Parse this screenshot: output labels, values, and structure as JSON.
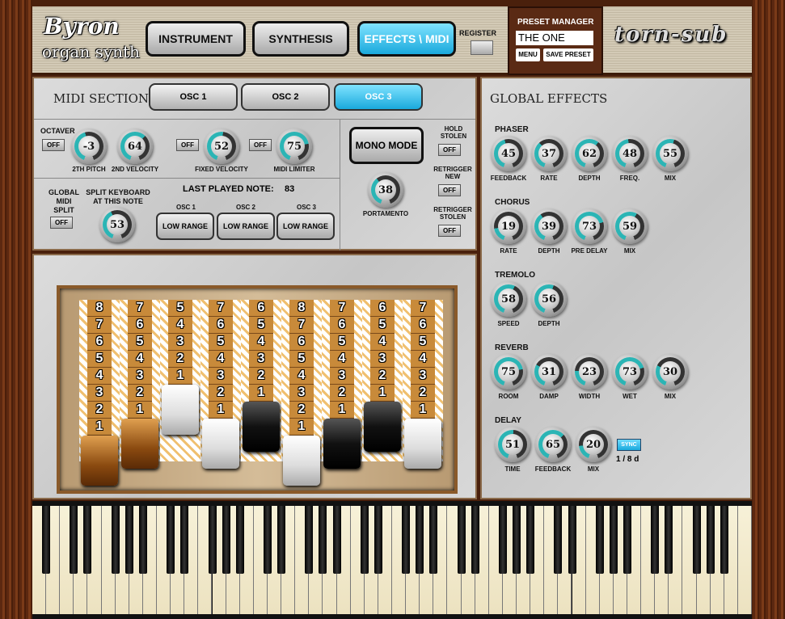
{
  "header": {
    "logo_title": "Byron",
    "logo_subtitle": "organ synth",
    "tabs": [
      {
        "label": "INSTRUMENT"
      },
      {
        "label": "SYNTHESIS"
      },
      {
        "label": "EFFECTS \\ MIDI",
        "active": true
      }
    ],
    "register_label": "REGISTER",
    "brand": "torn-sub"
  },
  "preset": {
    "title": "PRESET MANAGER",
    "name": "THE ONE",
    "menu": "MENU",
    "save": "SAVE PRESET"
  },
  "midi": {
    "title": "MIDI SECTION",
    "osc_tabs": [
      "OSC 1",
      "OSC 2",
      "OSC 3"
    ],
    "active_osc": "OSC 3",
    "octaver_label": "OCTAVER",
    "off": "OFF",
    "knobs": {
      "pitch": {
        "value": "-3",
        "level": 0.45,
        "label": "2TH PITCH"
      },
      "velocity2": {
        "value": "64",
        "level": 0.64,
        "label": "2ND VELOCITY"
      },
      "fixed": {
        "value": "52",
        "level": 0.52,
        "label": "FIXED VELOCITY"
      },
      "limiter": {
        "value": "75",
        "level": 0.75,
        "label": "MIDI LIMITER"
      },
      "split": {
        "value": "53",
        "level": 0.42,
        "label": "SPLIT KEYBOARD AT THIS NOTE"
      },
      "portamento": {
        "value": "38",
        "level": 0.38,
        "label": "PORTAMENTO"
      }
    },
    "global_split": "GLOBAL MIDI SPLIT",
    "last_note_label": "LAST PLAYED NOTE:",
    "last_note": "83",
    "ranges": [
      {
        "osc": "OSC 1",
        "value": "LOW RANGE"
      },
      {
        "osc": "OSC 2",
        "value": "LOW RANGE"
      },
      {
        "osc": "OSC 3",
        "value": "LOW RANGE"
      }
    ],
    "mono_mode": "MONO MODE",
    "hold_stolen": "HOLD STOLEN",
    "retrigger_new": "RETRIGGER NEW",
    "retrigger_stolen": "RETRIGGER STOLEN"
  },
  "drawbars": [
    {
      "value": 8,
      "color": "brown"
    },
    {
      "value": 7,
      "color": "brown"
    },
    {
      "value": 5,
      "color": "white"
    },
    {
      "value": 7,
      "color": "white"
    },
    {
      "value": 6,
      "color": "black"
    },
    {
      "value": 8,
      "color": "white"
    },
    {
      "value": 7,
      "color": "black"
    },
    {
      "value": 6,
      "color": "black"
    },
    {
      "value": 7,
      "color": "white"
    }
  ],
  "effects": {
    "title": "GLOBAL EFFECTS",
    "phaser": {
      "title": "PHASER",
      "knobs": [
        {
          "label": "FEEDBACK",
          "value": "45"
        },
        {
          "label": "RATE",
          "value": "37"
        },
        {
          "label": "DEPTH",
          "value": "62"
        },
        {
          "label": "FREQ.",
          "value": "48"
        },
        {
          "label": "MIX",
          "value": "55"
        }
      ]
    },
    "chorus": {
      "title": "CHORUS",
      "knobs": [
        {
          "label": "RATE",
          "value": "19"
        },
        {
          "label": "DEPTH",
          "value": "39"
        },
        {
          "label": "PRE DELAY",
          "value": "73"
        },
        {
          "label": "MIX",
          "value": "59"
        }
      ]
    },
    "tremolo": {
      "title": "TREMOLO",
      "knobs": [
        {
          "label": "SPEED",
          "value": "58"
        },
        {
          "label": "DEPTH",
          "value": "56"
        }
      ]
    },
    "reverb": {
      "title": "REVERB",
      "knobs": [
        {
          "label": "ROOM",
          "value": "75"
        },
        {
          "label": "DAMP",
          "value": "31"
        },
        {
          "label": "WIDTH",
          "value": "23"
        },
        {
          "label": "WET",
          "value": "73"
        },
        {
          "label": "MIX",
          "value": "30"
        }
      ]
    },
    "delay": {
      "title": "DELAY",
      "knobs": [
        {
          "label": "TIME",
          "value": "51"
        },
        {
          "label": "FEEDBACK",
          "value": "65"
        },
        {
          "label": "MIX",
          "value": "20"
        }
      ],
      "sync": "SYNC",
      "division": "1 / 8 d"
    }
  },
  "colors": {
    "accent": "#1aa9dc",
    "knob_arc": "#2bb5b5",
    "wood": "#5c2810"
  }
}
